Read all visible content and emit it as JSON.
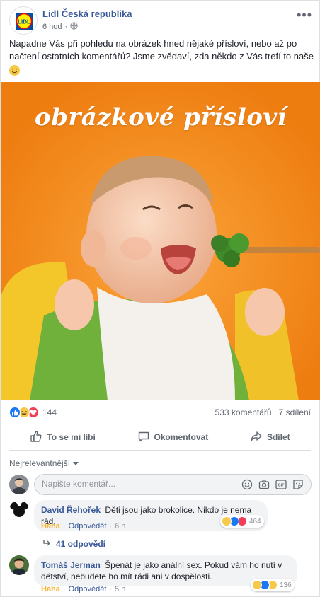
{
  "post": {
    "page_name": "Lidl Česká republika",
    "time": "6 hod",
    "logo_text": "LIDL",
    "text": "Napadne Vás při pohledu na obrázek hned nějaké přísloví, nebo až po načtení ostatních komentářů? Jsme zvědaví, zda někdo z Vás trefí to naše",
    "image_caption": "obrázkové přísloví"
  },
  "stats": {
    "reactions_count": "144",
    "comments": "533 komentářů",
    "shares": "7 sdílení"
  },
  "actions": {
    "like": "To se mi líbí",
    "comment": "Okomentovat",
    "share": "Sdílet"
  },
  "comments_section": {
    "sort_label": "Nejrelevantnější",
    "composer_placeholder": "Napište komentář..."
  },
  "comments": [
    {
      "author": "David Řehořek",
      "text": "Děti jsou jako brokolice. Nikdo je nema rád.",
      "reaction": "Haha",
      "reply": "Odpovědět",
      "time": "6 h",
      "reaction_count": "464",
      "replies_label": "41 odpovědí"
    },
    {
      "author": "Tomáš Jerman",
      "text": "Špenát je jako anální sex. Pokud vám ho nutí v dětství, nebudete ho mít rádi ani v dospělosti.",
      "reaction": "Haha",
      "reply": "Odpovědět",
      "time": "5 h",
      "reaction_count": "136"
    }
  ],
  "colors": {
    "link_blue": "#385898",
    "like_blue": "#1877f2",
    "haha_yellow": "#f7b125",
    "love_red": "#f33e58",
    "image_orange": "#f38b1b"
  },
  "icons": [
    "globe-icon",
    "more-icon",
    "like-icon",
    "comment-icon",
    "share-icon",
    "emoji-icon",
    "camera-icon",
    "gif-icon",
    "sticker-icon",
    "reply-arrow-icon",
    "chevron-down-icon"
  ]
}
